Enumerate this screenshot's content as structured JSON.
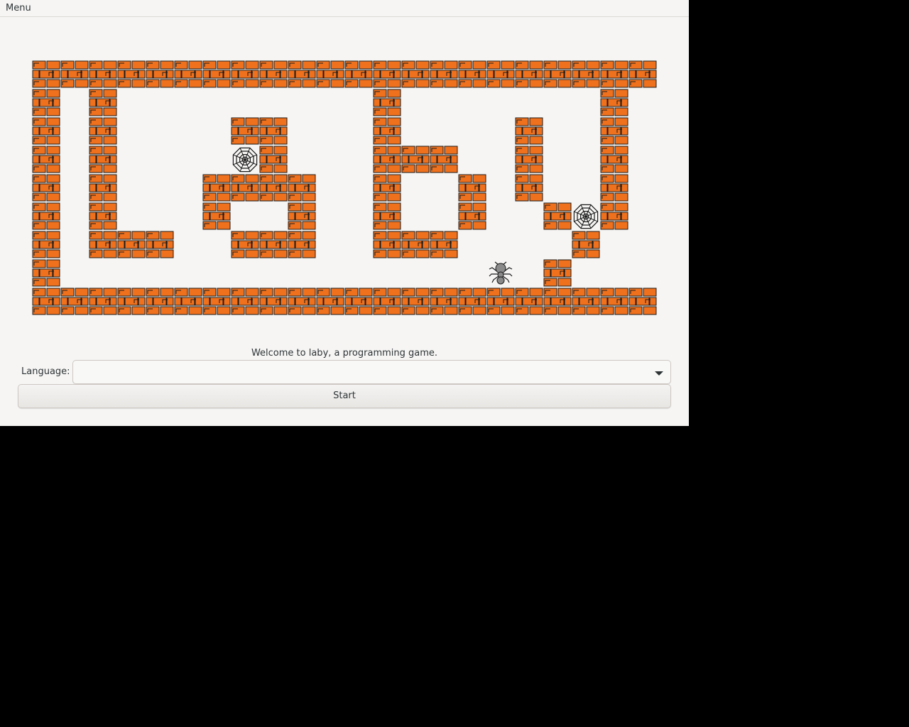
{
  "menubar": {
    "menu_label": "Menu"
  },
  "game": {
    "map": [
      "wwwwwwwwwwwwwwwwwwwwww",
      "w.w.........w.......w",
      "w.w....ww...w....w..w.w",
      "w.w....rw...www..w..w.w",
      "w.w...wwww..w..w.w..w.w",
      "w.w...w..w..w..w..wrw.w",
      "w.www..www..www....w..w",
      "w...............a.w...w",
      "wwwwwwwwwwwwwwwwwwwwww"
    ],
    "legend": {
      "w": "wall",
      "r": "web",
      ".": "empty",
      "a": "ant"
    },
    "colors": {
      "brick": "#f0711d",
      "mortar": "#1a1a1a",
      "ant_body": "#8a8a8a"
    }
  },
  "footer": {
    "welcome": "Welcome to laby, a programming game.",
    "language_label": "Language:",
    "language_value": "",
    "start_label": "Start"
  },
  "icons": {
    "combo_arrow": "chevron-down-icon"
  }
}
